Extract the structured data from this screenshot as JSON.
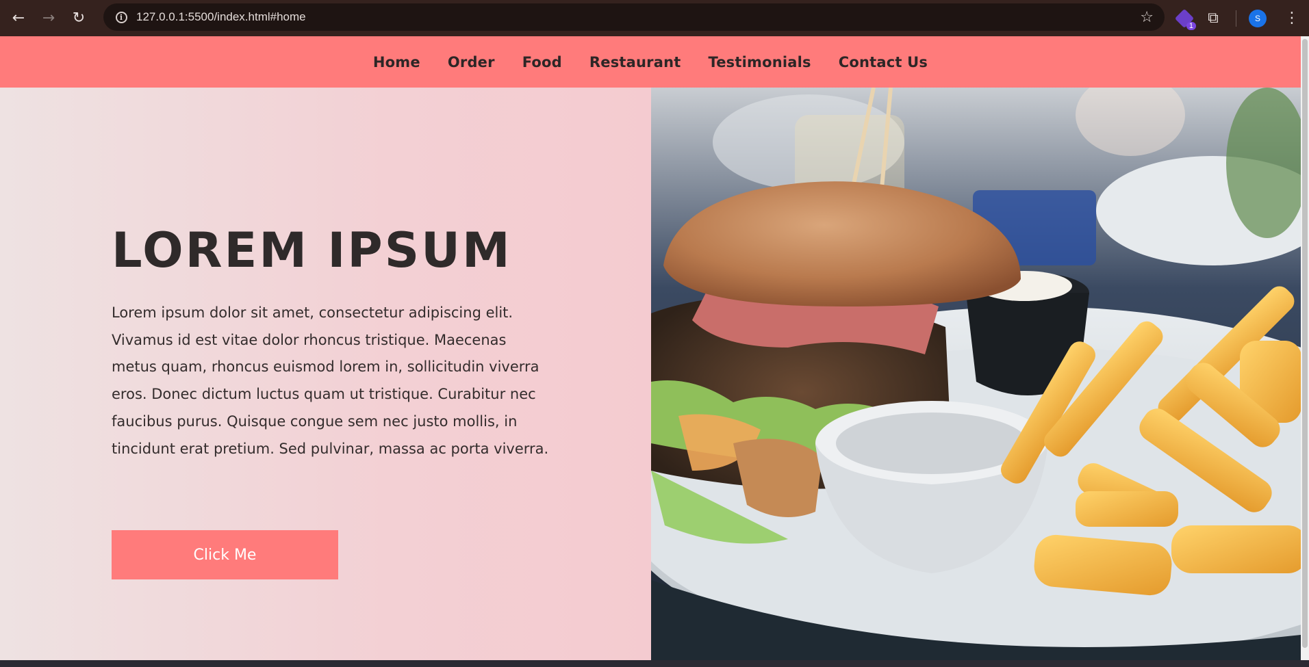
{
  "browser": {
    "url_host": "127.0.0.1",
    "url_rest": ":5500/index.html#home",
    "extension_badge": "1",
    "profile_initial": "S"
  },
  "nav": {
    "links": [
      "Home",
      "Order",
      "Food",
      "Restaurant",
      "Testimonials",
      "Contact Us"
    ]
  },
  "hero": {
    "title": "LOREM IPSUM",
    "paragraph": "Lorem ipsum dolor sit amet, consectetur adipiscing elit. Vivamus id est vitae dolor rhoncus tristique. Maecenas metus quam, rhoncus euismod lorem in, sollicitudin viverra eros. Donec dictum luctus quam ut tristique. Curabitur nec faucibus purus. Quisque congue sem nec justo mollis, in tincidunt erat pretium. Sed pulvinar, massa ac porta viverra.",
    "button_label": "Click Me",
    "image_subject": "burger-with-fries-and-dips"
  },
  "colors": {
    "nav_bg": "#ff7b7b",
    "button_bg": "#ff7b7b",
    "title": "#2f2a2a"
  }
}
